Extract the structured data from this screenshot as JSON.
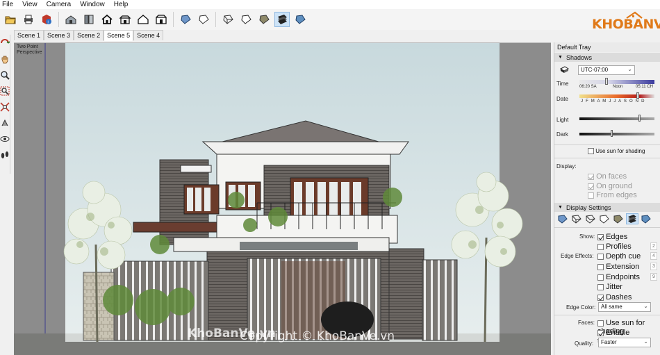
{
  "menu": [
    "File",
    "View",
    "Camera",
    "Window",
    "Help"
  ],
  "logo": {
    "text": "KHOBANVE",
    "color": "#e07a1a"
  },
  "toolbar": {
    "buttons": [
      "print-icon",
      "model-info-icon",
      "warehouse-icon",
      "components-icon",
      "home-icon",
      "front-view-icon",
      "house-outline-icon",
      "side-view-icon",
      "xray-style-icon",
      "back-edges-style-icon",
      "wireframe-style-icon",
      "hidden-line-style-icon",
      "shaded-style-icon",
      "textured-style-icon",
      "monochrome-style-icon"
    ]
  },
  "scenes": [
    "Scene 1",
    "Scene 3",
    "Scene 2",
    "Scene 5",
    "Scene 4"
  ],
  "active_scene": "Scene 5",
  "viewport": {
    "label_line1": "Two Point",
    "label_line2": "Perspective",
    "watermark_logo": "KhoBanVe.vn",
    "watermark_copyright": "Copyright © KhoBanVe.vn"
  },
  "tray": {
    "title": "Default Tray",
    "shadows": {
      "header": "Shadows",
      "timezone": "UTC-07:00",
      "time_label": "Time",
      "time_start": "06:20 SA",
      "time_mid": "Noon",
      "time_end": "05:11 CH",
      "date_label": "Date",
      "months": "J F M A M J J A S O N D",
      "light_label": "Light",
      "dark_label": "Dark",
      "use_sun": "Use sun for shading",
      "display_label": "Display:",
      "on_faces": "On faces",
      "on_ground": "On ground",
      "from_edges": "From edges",
      "light_level": 0.9,
      "dark_level": 0.33
    },
    "display": {
      "header": "Display Settings",
      "show_label": "Show:",
      "edges": "Edges",
      "profiles": "Profiles",
      "profiles_num": "2",
      "edge_effects_label": "Edge Effects:",
      "depth_cue": "Depth cue",
      "depth_cue_num": "4",
      "extension": "Extension",
      "extension_num": "3",
      "endpoints": "Endpoints",
      "endpoints_num": "9",
      "jitter": "Jitter",
      "dashes": "Dashes",
      "edge_color_label": "Edge Color:",
      "edge_color": "All same",
      "faces_label": "Faces:",
      "faces_use_sun": "Use sun for shading",
      "enable_transparency": "Enable transparency",
      "quality_label": "Quality:",
      "quality": "Faster"
    }
  }
}
